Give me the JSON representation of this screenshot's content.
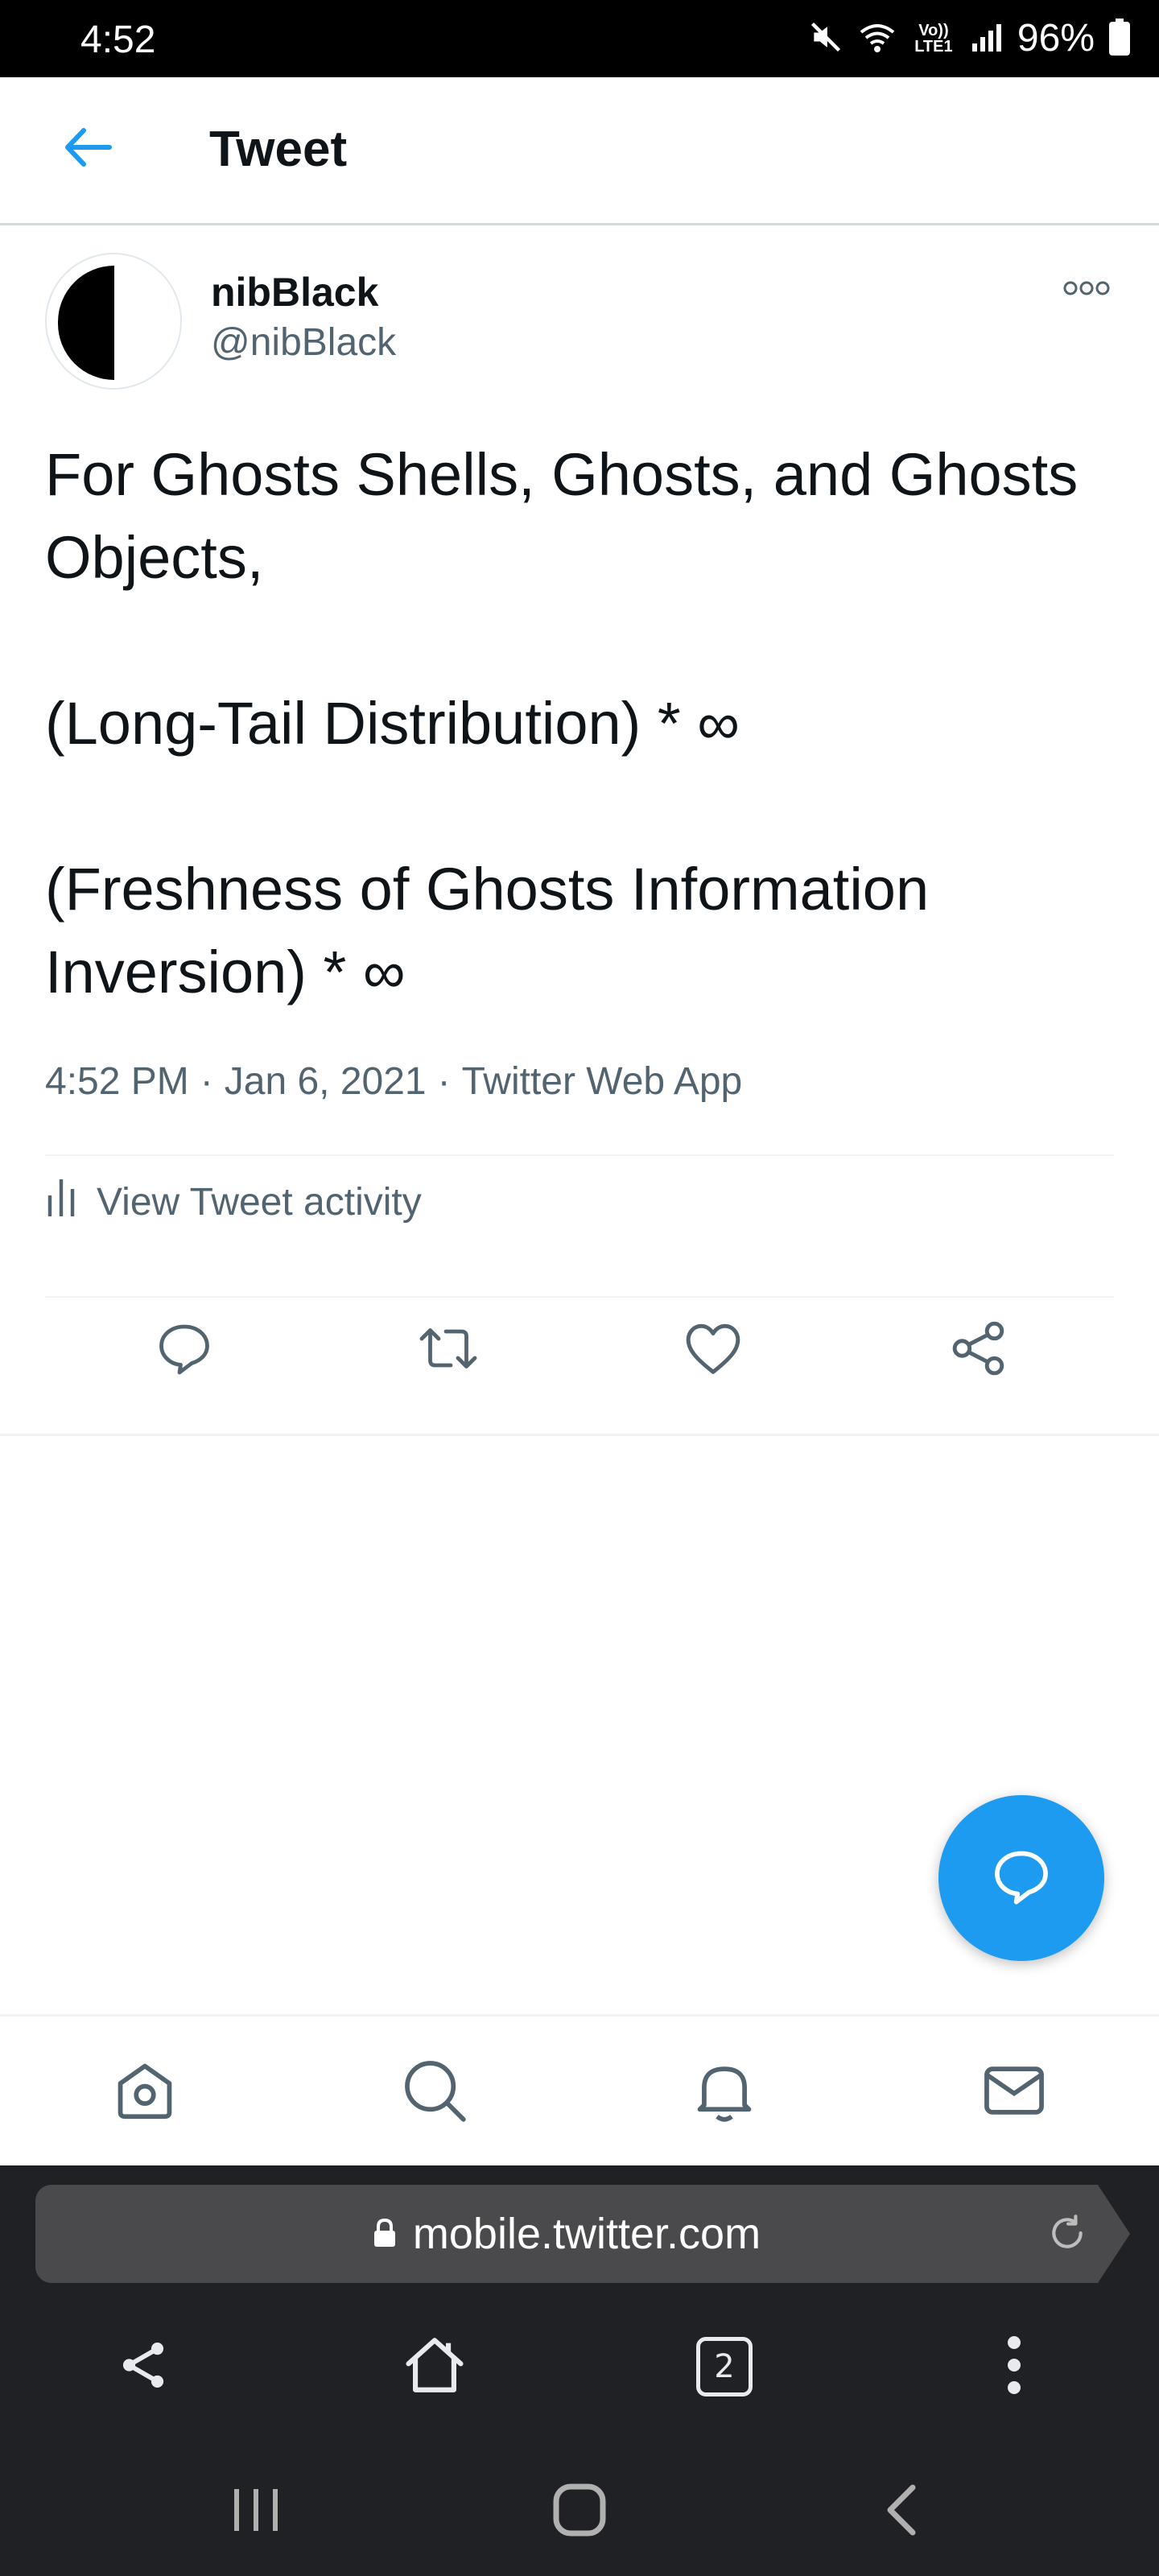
{
  "status_bar": {
    "time": "4:52",
    "network_label": "Vo)) LTE1",
    "battery": "96%"
  },
  "header": {
    "title": "Tweet",
    "back_icon": "arrow-left-icon"
  },
  "tweet": {
    "display_name": "nibBlack",
    "handle": "@nibBlack",
    "more_icon": "more-dots-icon",
    "paragraphs": [
      "For Ghosts Shells, Ghosts, and Ghosts Objects,",
      "(Long-Tail Distribution) * ∞",
      "(Freshness of Ghosts Information Inversion) * ∞"
    ],
    "time": "4:52 PM",
    "date": "Jan 6, 2021",
    "source": "Twitter Web App",
    "separator": "·",
    "activity_label": "View Tweet activity"
  },
  "actions": [
    "reply-icon",
    "retweet-icon",
    "like-icon",
    "share-icon"
  ],
  "bottom_nav": [
    "home-icon",
    "search-icon",
    "notifications-icon",
    "messages-icon"
  ],
  "browser": {
    "url": "mobile.twitter.com",
    "tab_count": "2"
  },
  "colors": {
    "accent": "#1d9bf0",
    "secondary_text": "#536471",
    "primary_text": "#0f1419",
    "browser_bg": "#202124",
    "url_bar": "#4a4a4c"
  }
}
